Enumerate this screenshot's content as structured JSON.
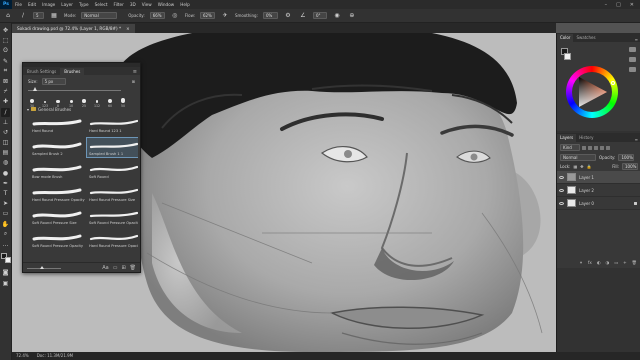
{
  "app": {
    "logo": "Ps"
  },
  "menu": [
    "File",
    "Edit",
    "Image",
    "Layer",
    "Type",
    "Select",
    "Filter",
    "3D",
    "View",
    "Window",
    "Help"
  ],
  "window_controls": [
    "–",
    "□",
    "✕"
  ],
  "options_bar": {
    "brush_size": "5",
    "mode_label": "Mode:",
    "mode_value": "Normal",
    "opacity_label": "Opacity:",
    "opacity_value": "66%",
    "flow_label": "Flow:",
    "flow_value": "62%",
    "smoothing_label": "Smoothing:",
    "smoothing_value": "0%",
    "angle_value": "0°"
  },
  "document": {
    "tab_title": "Sokadi drawing.psd @ 72.4% (Layer 1, RGB/8#) *",
    "close_glyph": "×"
  },
  "status": {
    "zoom": "72.4%",
    "doc_info": "Doc: 11.3M/21.9M"
  },
  "tools": [
    {
      "icon": "move-tool-icon",
      "glyph": "✥"
    },
    {
      "icon": "marquee-tool-icon",
      "glyph": "⬚"
    },
    {
      "icon": "lasso-tool-icon",
      "glyph": "ʘ"
    },
    {
      "icon": "quick-select-tool-icon",
      "glyph": "✎"
    },
    {
      "icon": "crop-tool-icon",
      "glyph": "⌗"
    },
    {
      "icon": "frame-tool-icon",
      "glyph": "⊠"
    },
    {
      "icon": "eyedropper-tool-icon",
      "glyph": "⌿"
    },
    {
      "icon": "healing-tool-icon",
      "glyph": "✚"
    },
    {
      "icon": "brush-tool-icon",
      "glyph": "∕"
    },
    {
      "icon": "stamp-tool-icon",
      "glyph": "⊥"
    },
    {
      "icon": "history-brush-tool-icon",
      "glyph": "↺"
    },
    {
      "icon": "eraser-tool-icon",
      "glyph": "◫"
    },
    {
      "icon": "gradient-tool-icon",
      "glyph": "▤"
    },
    {
      "icon": "blur-tool-icon",
      "glyph": "◍"
    },
    {
      "icon": "dodge-tool-icon",
      "glyph": "●"
    },
    {
      "icon": "pen-tool-icon",
      "glyph": "✒"
    },
    {
      "icon": "type-tool-icon",
      "glyph": "T"
    },
    {
      "icon": "path-select-tool-icon",
      "glyph": "➤"
    },
    {
      "icon": "shape-tool-icon",
      "glyph": "▭"
    },
    {
      "icon": "hand-tool-icon",
      "glyph": "✋"
    },
    {
      "icon": "zoom-tool-icon",
      "glyph": "⌕"
    },
    {
      "icon": "more-tools-icon",
      "glyph": "…"
    }
  ],
  "colors": {
    "foreground": "#1b1b1b",
    "background": "#f2f2f2",
    "accent_selection": "#6d96b8",
    "folder": "#c8a33b"
  },
  "brushes_panel": {
    "tabs": [
      "Brush Settings",
      "Brushes"
    ],
    "active_tab": "Brushes",
    "size_label": "Size:",
    "size_value": "5 px",
    "size_slider_fraction": 0.06,
    "tips": [
      {
        "size": "30",
        "r": 2.2
      },
      {
        "size": "123",
        "r": 1.2
      },
      {
        "size": "8",
        "r": 1.6
      },
      {
        "size": "10",
        "r": 1.5
      },
      {
        "size": "25",
        "r": 1.8
      },
      {
        "size": "112",
        "r": 1.4
      },
      {
        "size": "60",
        "r": 2.0
      },
      {
        "size": "50",
        "r": 2.3
      }
    ],
    "groups": [
      {
        "name": "General Brushes",
        "open": true,
        "brushes": [
          {
            "name": "Hard Round",
            "selected": false
          },
          {
            "name": "Hard Round 123 1",
            "selected": false
          },
          {
            "name": "Sampled Brush 2",
            "selected": false
          },
          {
            "name": "Sampled Brush 1 1",
            "selected": true
          },
          {
            "name": "Bow mode Brush",
            "selected": false
          },
          {
            "name": "Soft Round",
            "selected": false
          },
          {
            "name": "Hard Round Pressure Opacity",
            "selected": false
          },
          {
            "name": "Hard Round Pressure Size",
            "selected": false
          },
          {
            "name": "Soft Round Pressure Size",
            "selected": false
          },
          {
            "name": "Soft Round Pressure Opacity",
            "selected": false
          },
          {
            "name": "Soft Round Pressure Opacity",
            "selected": false
          },
          {
            "name": "Hard Round Pressure Opacity",
            "selected": false
          }
        ]
      },
      {
        "name": "Dry Media Brushes",
        "open": false,
        "brushes": []
      },
      {
        "name": "Special Effects Brushes",
        "open": false,
        "brushes": []
      }
    ],
    "single_brush_name": "Spiky",
    "footer_slider_fraction": 0.42,
    "footer_hint": "Aa"
  },
  "color_panel": {
    "tabs": [
      "Color",
      "Swatches"
    ],
    "active_tab": "Color"
  },
  "layers_panel": {
    "tabs": [
      "Layers",
      "History"
    ],
    "active_tab": "Layers",
    "kind_label": "Kind",
    "blend_mode": "Normal",
    "opacity_label": "Opacity:",
    "opacity_value": "100%",
    "lock_label": "Lock:",
    "fill_label": "Fill:",
    "fill_value": "100%",
    "layers": [
      {
        "name": "Layer 1",
        "selected": true,
        "visible": true,
        "drawn": true,
        "locked": false
      },
      {
        "name": "Layer 2",
        "selected": false,
        "visible": true,
        "drawn": false,
        "locked": false
      },
      {
        "name": "Layer 0",
        "selected": false,
        "visible": true,
        "drawn": false,
        "locked": true
      }
    ],
    "footer_icons": [
      "link-icon",
      "fx-icon",
      "mask-icon",
      "adjustment-icon",
      "folder-icon",
      "new-layer-icon",
      "trash-icon"
    ],
    "footer_glyphs": [
      "⚭",
      "fx",
      "◐",
      "◑",
      "▭",
      "+",
      "🗑"
    ]
  }
}
